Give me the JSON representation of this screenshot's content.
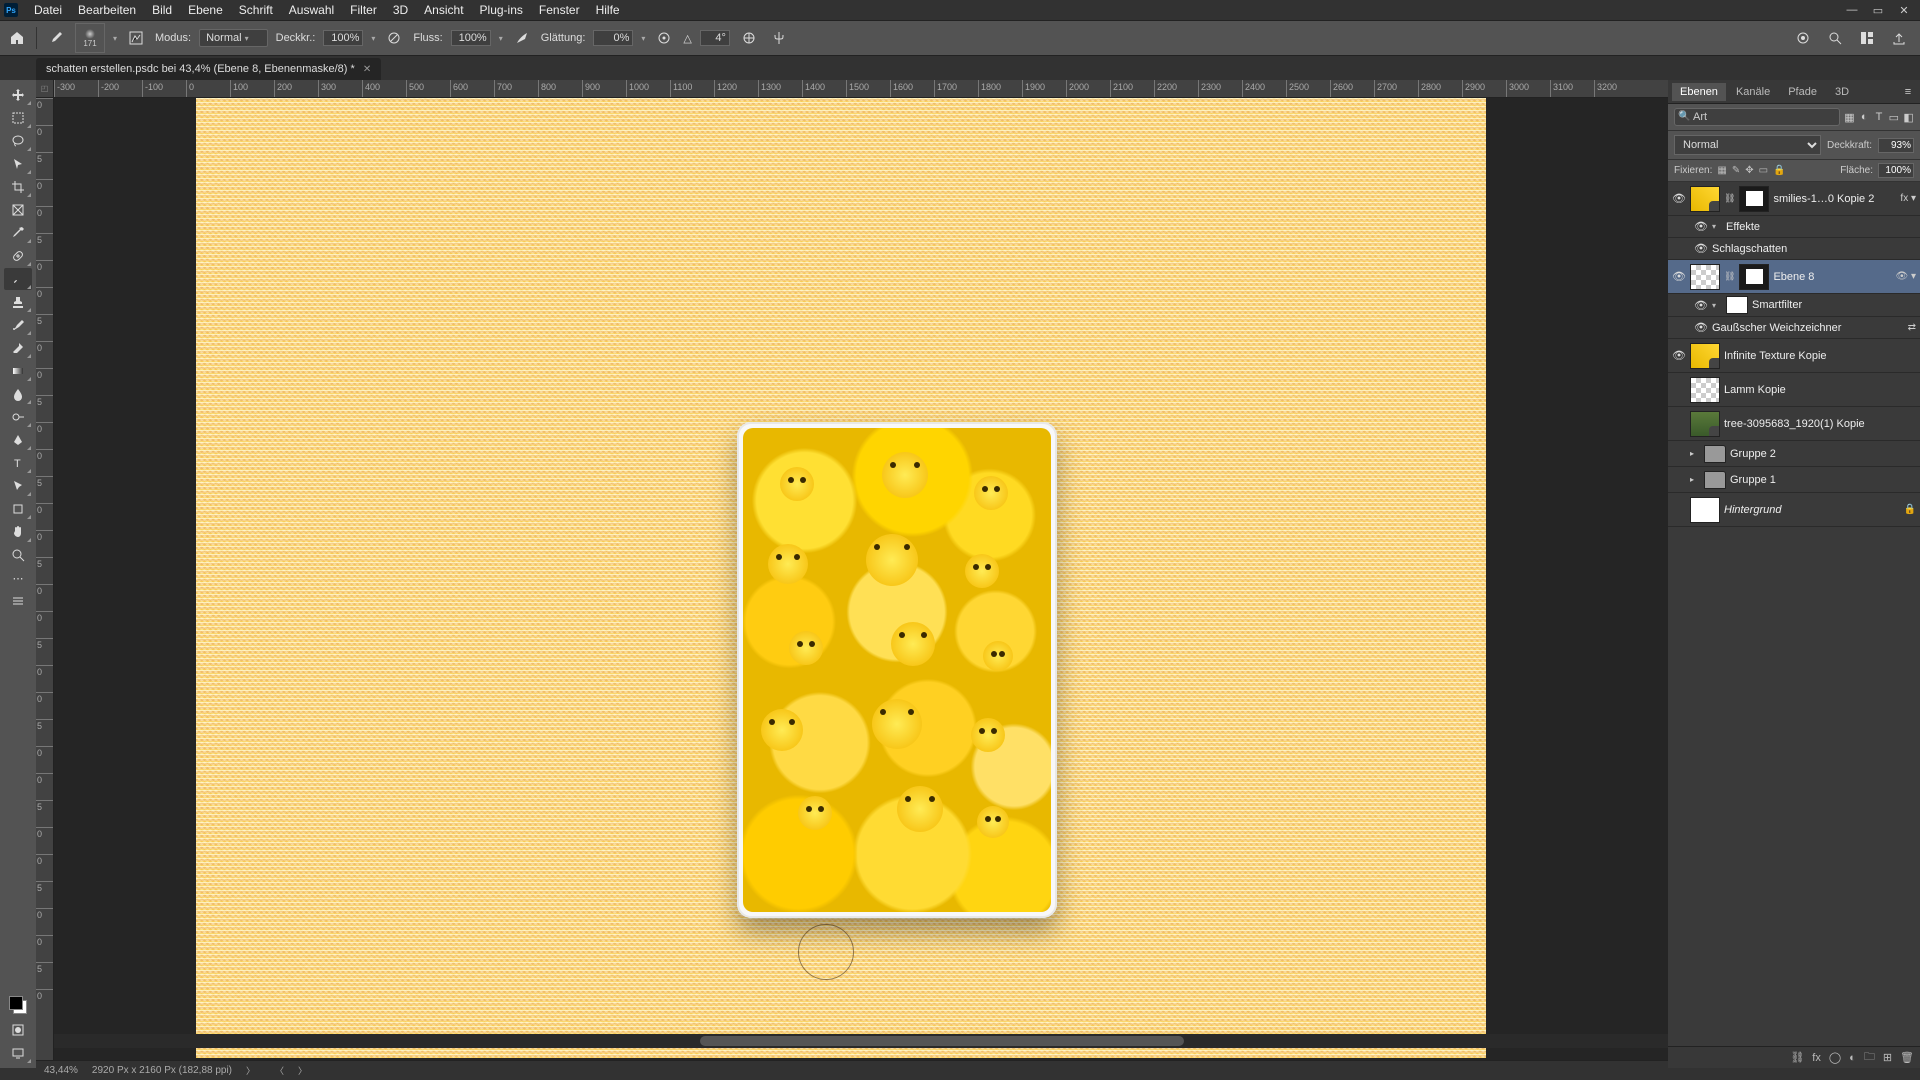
{
  "app": {
    "logo": "Ps"
  },
  "menu": [
    "Datei",
    "Bearbeiten",
    "Bild",
    "Ebene",
    "Schrift",
    "Auswahl",
    "Filter",
    "3D",
    "Ansicht",
    "Plug-ins",
    "Fenster",
    "Hilfe"
  ],
  "window_controls": {
    "min": "—",
    "restore": "▭",
    "close": "✕"
  },
  "options": {
    "brush_size": "171",
    "mode_label": "Modus:",
    "mode_value": "Normal",
    "opacity_label": "Deckkr.:",
    "opacity_value": "100%",
    "flow_label": "Fluss:",
    "flow_value": "100%",
    "smoothing_label": "Glättung:",
    "smoothing_value": "0%",
    "angle_icon": "△",
    "angle_value": "4°"
  },
  "document": {
    "tab_title": "schatten erstellen.psdc bei 43,4% (Ebene 8, Ebenenmaske/8) *"
  },
  "ruler_h": [
    "-300",
    "-200",
    "-100",
    "0",
    "100",
    "200",
    "300",
    "400",
    "500",
    "600",
    "700",
    "800",
    "900",
    "1000",
    "1100",
    "1200",
    "1300",
    "1400",
    "1500",
    "1600",
    "1700",
    "1800",
    "1900",
    "2000",
    "2100",
    "2200",
    "2300",
    "2400",
    "2500",
    "2600",
    "2700",
    "2800",
    "2900",
    "3000",
    "3100",
    "3200"
  ],
  "ruler_v": [
    "0",
    "0",
    "5",
    "0",
    "0",
    "5",
    "0",
    "0",
    "5",
    "0",
    "0",
    "5",
    "0",
    "0",
    "5",
    "0",
    "0",
    "5",
    "0",
    "0",
    "5",
    "0",
    "0",
    "5",
    "0",
    "0",
    "5",
    "0",
    "0",
    "5",
    "0",
    "0",
    "5",
    "0"
  ],
  "panels": {
    "tabs": [
      "Ebenen",
      "Kanäle",
      "Pfade",
      "3D"
    ],
    "active_tab": 0,
    "search_placeholder": "Art",
    "blend_mode": "Normal",
    "opacity_label": "Deckkraft:",
    "opacity_value": "93%",
    "lock_label": "Fixieren:",
    "fill_label": "Fläche:",
    "fill_value": "100%"
  },
  "layers": [
    {
      "visible": true,
      "thumbs": [
        "emoji",
        "mask"
      ],
      "link": true,
      "name": "smilies-1…0 Kopie 2",
      "fx": true
    },
    {
      "sub": true,
      "visible": true,
      "name": "Effekte",
      "arrow": true
    },
    {
      "sub": true,
      "visible": true,
      "name": "Schlagschatten"
    },
    {
      "visible": true,
      "thumbs": [
        "checker",
        "mask"
      ],
      "link": true,
      "name": "Ebene 8",
      "selected": true,
      "fx_eye": true
    },
    {
      "sub": true,
      "visible": true,
      "thumbs": [
        "white-small"
      ],
      "name": "Smartfilter",
      "arrow": true
    },
    {
      "sub": true,
      "visible": true,
      "name": "Gaußscher Weichzeichner",
      "adj": true
    },
    {
      "visible": true,
      "thumbs": [
        "emoji"
      ],
      "name": "Infinite Texture Kopie"
    },
    {
      "visible": false,
      "thumbs": [
        "checker"
      ],
      "name": "Lamm Kopie"
    },
    {
      "visible": false,
      "thumbs": [
        "tree"
      ],
      "name": "tree-3095683_1920(1) Kopie"
    },
    {
      "visible": false,
      "group": true,
      "name": "Gruppe 2"
    },
    {
      "visible": false,
      "group": true,
      "name": "Gruppe 1"
    },
    {
      "visible": false,
      "thumbs": [
        "white"
      ],
      "name": "Hintergrund",
      "locked": true,
      "italic": true
    }
  ],
  "status": {
    "zoom": "43,44%",
    "doc": "2920 Px x 2160 Px (182,88 ppi)"
  }
}
